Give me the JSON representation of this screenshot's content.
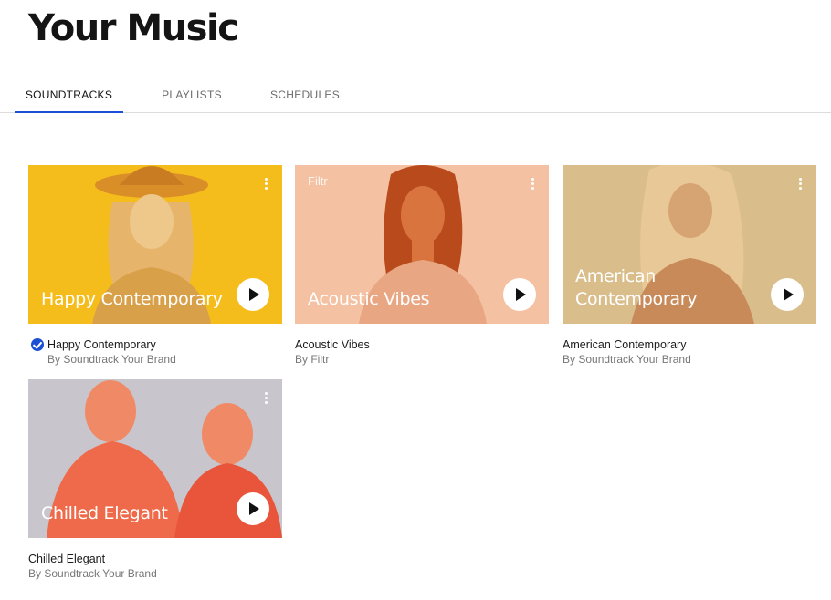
{
  "page_title": "Your Music",
  "tabs": [
    {
      "label": "SOUNDTRACKS",
      "active": true
    },
    {
      "label": "PLAYLISTS",
      "active": false
    },
    {
      "label": "SCHEDULES",
      "active": false
    }
  ],
  "cards": [
    {
      "art_title": "Happy Contemporary",
      "curator_tag": "",
      "name": "Happy Contemporary",
      "by": "By Soundtrack Your Brand",
      "selected": true,
      "color": "#f5bd1c",
      "figure_color": "#e0a321"
    },
    {
      "art_title": "Acoustic Vibes",
      "curator_tag": "Filtr",
      "name": "Acoustic Vibes",
      "by": "By Filtr",
      "selected": false,
      "color": "#f4c2a2",
      "figure_color": "#d4622c"
    },
    {
      "art_title": "American Contemporary",
      "curator_tag": "",
      "name": "American Contemporary",
      "by": "By Soundtrack Your Brand",
      "selected": false,
      "color": "#d9be8c",
      "figure_color": "#c38a52"
    },
    {
      "art_title": "Chilled Elegant",
      "curator_tag": "",
      "name": "Chilled Elegant",
      "by": "By Soundtrack Your Brand",
      "selected": false,
      "color": "#c8c6cc",
      "figure_color": "#ee6a4a"
    }
  ],
  "icons": {
    "menu": "more-vertical-icon",
    "play": "play-icon",
    "check": "check-circle-icon"
  },
  "colors": {
    "accent": "#1b4fd6"
  }
}
